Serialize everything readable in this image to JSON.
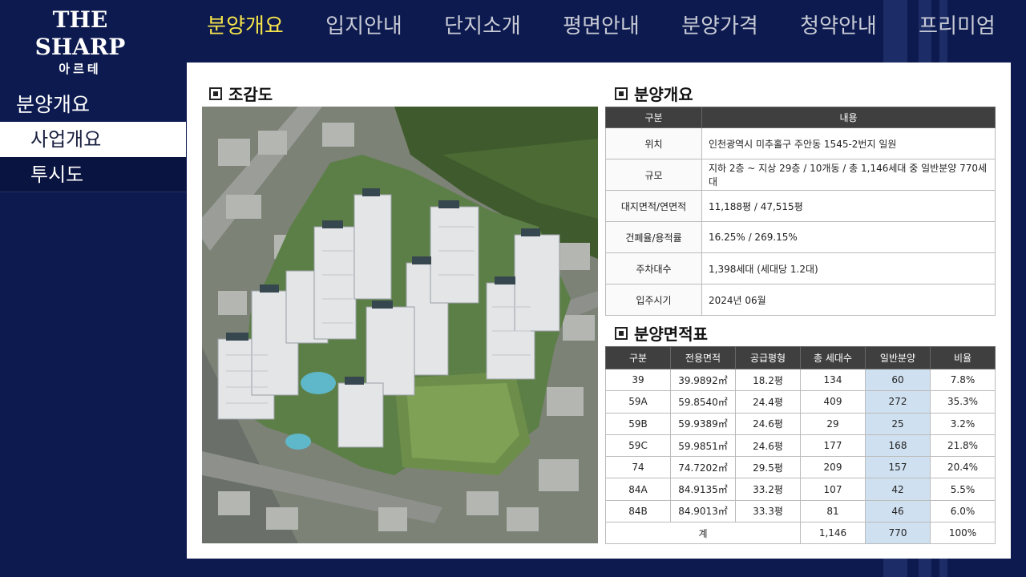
{
  "brand": {
    "name": "THE SHARP",
    "sub": "아르테"
  },
  "nav": [
    "분양개요",
    "입지안내",
    "단지소개",
    "평면안내",
    "분양가격",
    "청약안내",
    "프리미엄"
  ],
  "sidebar": {
    "title": "분양개요",
    "items": [
      "사업개요",
      "투시도"
    ]
  },
  "sections": {
    "aerial": "조감도",
    "overview": "분양개요",
    "area": "분양면적표"
  },
  "overview_table": {
    "headers": [
      "구분",
      "내용"
    ],
    "rows": [
      [
        "위치",
        "인천광역시 미추홀구 주안동 1545-2번지 일원"
      ],
      [
        "규모",
        "지하 2층 ~ 지상 29층 / 10개동 /  총 1,146세대 중 일반분양 770세대"
      ],
      [
        "대지면적/연면적",
        "11,188평 / 47,515평"
      ],
      [
        "건폐율/용적률",
        "16.25% / 269.15%"
      ],
      [
        "주차대수",
        "1,398세대 (세대당 1.2대)"
      ],
      [
        "입주시기",
        "2024년  06월"
      ]
    ]
  },
  "area_table": {
    "headers": [
      "구분",
      "전용면적",
      "공급평형",
      "총 세대수",
      "일반분양",
      "비율"
    ],
    "rows": [
      [
        "39",
        "39.9892㎡",
        "18.2평",
        "134",
        "60",
        "7.8%"
      ],
      [
        "59A",
        "59.8540㎡",
        "24.4평",
        "409",
        "272",
        "35.3%"
      ],
      [
        "59B",
        "59.9389㎡",
        "24.6평",
        "29",
        "25",
        "3.2%"
      ],
      [
        "59C",
        "59.9851㎡",
        "24.6평",
        "177",
        "168",
        "21.8%"
      ],
      [
        "74",
        "74.7202㎡",
        "29.5평",
        "209",
        "157",
        "20.4%"
      ],
      [
        "84A",
        "84.9135㎡",
        "33.2평",
        "107",
        "42",
        "5.5%"
      ],
      [
        "84B",
        "84.9013㎡",
        "33.3평",
        "81",
        "46",
        "6.0%"
      ]
    ],
    "total": [
      "계",
      "1,146",
      "770",
      "100%"
    ]
  },
  "colors": {
    "background": "#0d1a4f",
    "nav_active": "#f5e44a",
    "table_header": "#3f3f3f",
    "highlight": "#cfe0f0"
  }
}
